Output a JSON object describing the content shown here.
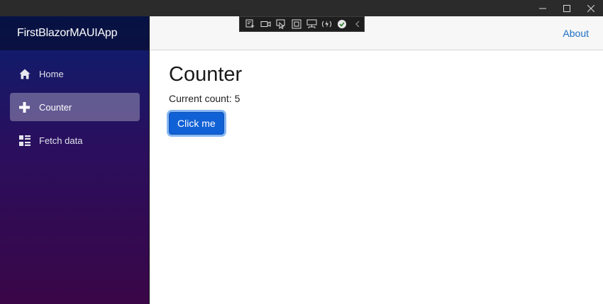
{
  "window": {
    "controls": [
      "minimize-icon",
      "maximize-icon",
      "close-icon"
    ]
  },
  "debug_toolbar": {
    "icons": [
      "select-element-icon",
      "video-icon",
      "pointer-icon",
      "frame-icon",
      "display-layout-icon",
      "hot-reload-icon",
      "check-circle-icon",
      "chevron-left-icon"
    ]
  },
  "sidebar": {
    "brand": "FirstBlazorMAUIApp",
    "items": [
      {
        "label": "Home",
        "icon": "home-icon",
        "active": false
      },
      {
        "label": "Counter",
        "icon": "plus-icon",
        "active": true
      },
      {
        "label": "Fetch data",
        "icon": "list-rich-icon",
        "active": false
      }
    ]
  },
  "top_row": {
    "about": "About"
  },
  "main": {
    "title": "Counter",
    "count_text": "Current count: 5",
    "button_label": "Click me"
  },
  "colors": {
    "link": "#1b6ec2",
    "button": "#1161d6",
    "sidebar_top": "#0a1f6e",
    "sidebar_bottom": "#3a0647"
  }
}
